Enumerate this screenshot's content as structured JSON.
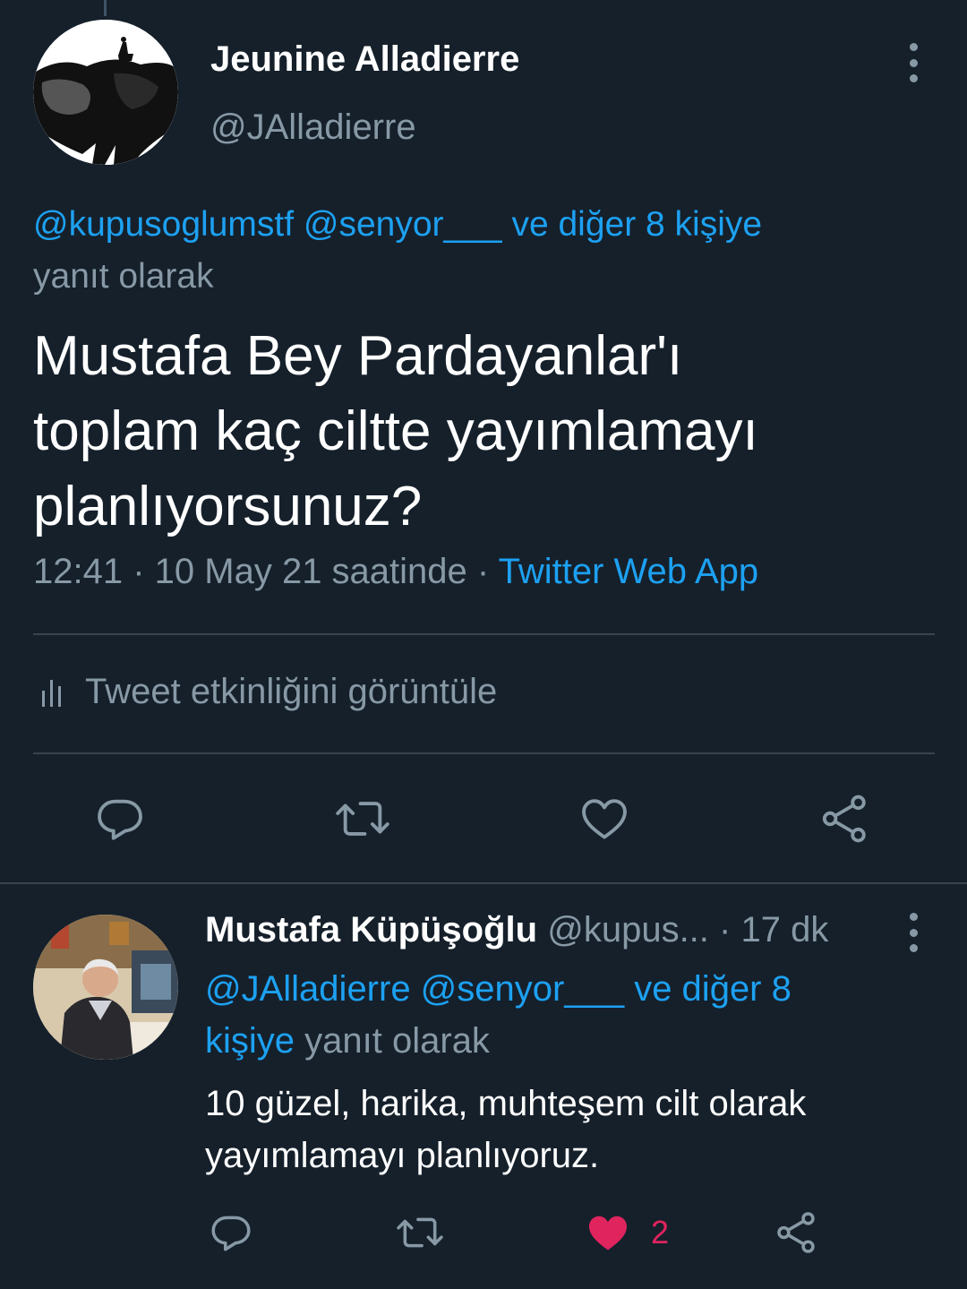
{
  "main_tweet": {
    "display_name": "Jeunine Alladierre",
    "handle": "@JAlladierre",
    "reply_to_mentions": "@kupusoglumstf @senyor___ ve diğer 8 kişiye",
    "reply_to_suffix": "yanıt olarak",
    "text_lines": [
      "Mustafa Bey Pardayanlar'ı",
      "toplam kaç ciltte yayımlamayı",
      "planlıyorsunuz?"
    ],
    "time": "12:41",
    "separator": " · ",
    "date": "10 May 21 saatinde",
    "source": "Twitter Web App",
    "activity_label": "Tweet etkinliğini görüntüle",
    "actions": [
      {
        "name": "reply",
        "icon": "reply-icon"
      },
      {
        "name": "retweet",
        "icon": "retweet-icon"
      },
      {
        "name": "like",
        "icon": "heart-icon"
      },
      {
        "name": "share",
        "icon": "share-icon"
      }
    ]
  },
  "reply_tweet": {
    "display_name": "Mustafa Küpüşoğlu",
    "handle": "@kupus...",
    "time_ago": "· 17 dk",
    "reply_to_mentions_1": "@JAlladierre @senyor___ ve diğer 8",
    "reply_to_mentions_2": "kişiye",
    "reply_to_suffix": "yanıt olarak",
    "text_lines": [
      "10 güzel, harika, muhteşem cilt olarak",
      "yayımlamayı planlıyoruz."
    ],
    "like_count": "2",
    "liked": true
  },
  "colors": {
    "background": "#15202b",
    "text": "#ffffff",
    "secondary": "#8899a6",
    "link": "#1da1f2",
    "like_active": "#e0245e",
    "divider": "#38444d"
  }
}
